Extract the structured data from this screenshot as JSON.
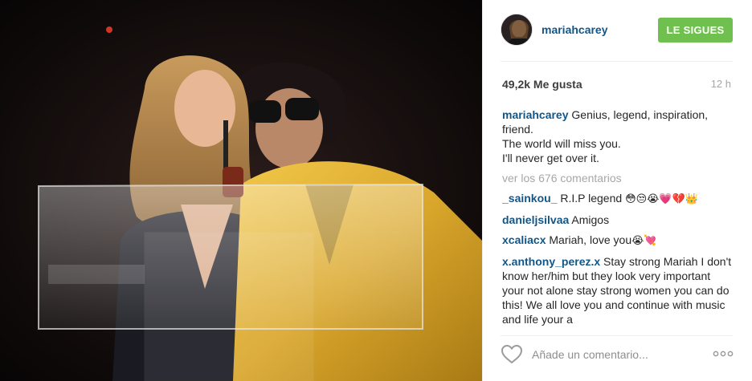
{
  "post": {
    "username": "mariahcarey",
    "follow_label": "LE SIGUES",
    "likes": "49,2k Me gusta",
    "time": "12 h"
  },
  "caption": {
    "username": "mariahcarey",
    "line1": "Genius, legend, inspiration, friend.",
    "line2": "The world will miss you.",
    "line3": "I'll never get over it."
  },
  "view_all_label": "ver los 676 comentarios",
  "comments": [
    {
      "username": "_sainkou_",
      "text": "R.I.P legend",
      "emojis": "😳😒😭💗💔👑"
    },
    {
      "username": "danieljsilvaa",
      "text": "Amigos",
      "emojis": ""
    },
    {
      "username": "xcaliacx",
      "text": "Mariah, love you",
      "emojis": "😭💘"
    },
    {
      "username": "x.anthony_perez.x",
      "text": "Stay strong Mariah I don't know her/him but they look very important your not alone stay strong women you can do this! We all love you and continue with music and life your a",
      "emojis": ""
    }
  ],
  "input": {
    "placeholder": "Añade un comentario..."
  },
  "icons": {
    "like": "heart-icon",
    "more": "more-options-icon"
  },
  "colors": {
    "follow": "#70c050",
    "username": "#125688",
    "muted": "#a5a7aa"
  }
}
